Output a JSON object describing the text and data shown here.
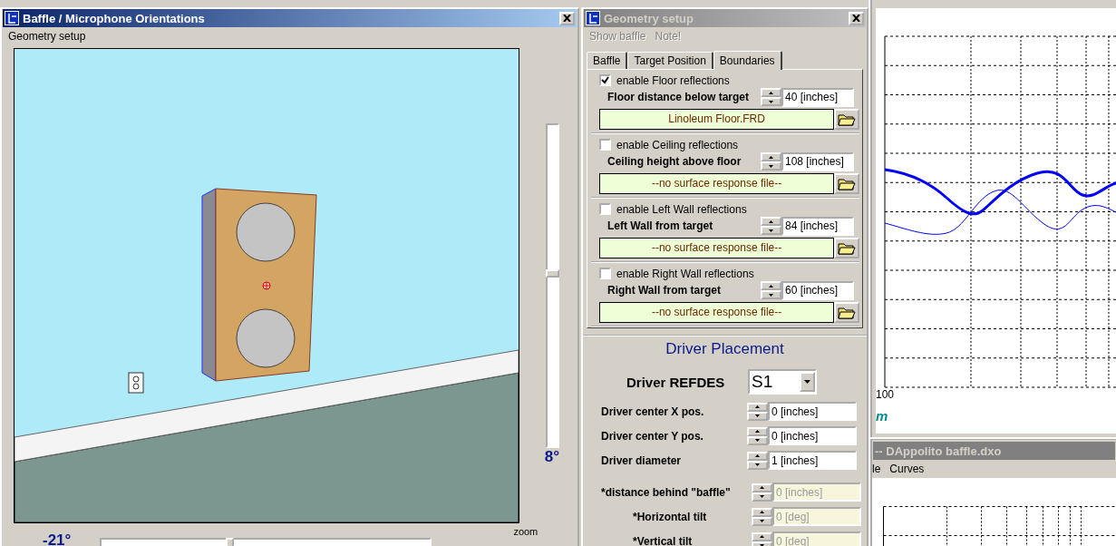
{
  "baffle_window": {
    "title": "Baffle / Microphone Orientations",
    "active": true,
    "menu": [
      "Geometry setup"
    ],
    "vertical_slider": {
      "level": 0.54
    },
    "vertical_angle": "8°",
    "horizontal_angle": "-21°",
    "horizontal_slider": {
      "level": 0.39
    },
    "zoom_label": "zoom"
  },
  "geometry_window": {
    "title": "Geometry setup",
    "active": false,
    "menu": [
      {
        "label": "Show baffle",
        "disabled": true
      },
      {
        "label": "Note!",
        "disabled": true
      }
    ],
    "tabs": [
      {
        "label": "Baffle",
        "selected": false
      },
      {
        "label": "Target Position",
        "selected": false
      },
      {
        "label": "Boundaries",
        "selected": true
      }
    ],
    "boundaries": [
      {
        "enable_label": "enable Floor reflections",
        "checked": true,
        "distance_label": "Floor distance below target",
        "value": "40 [inches]",
        "file": "Linoleum Floor.FRD"
      },
      {
        "enable_label": "enable Ceiling reflections",
        "checked": false,
        "distance_label": "Ceiling height above floor",
        "value": "108 [inches]",
        "file": "--no surface response file--"
      },
      {
        "enable_label": "enable Left Wall reflections",
        "checked": false,
        "distance_label": "Left Wall from target",
        "value": "84 [inches]",
        "file": "--no surface response file--"
      },
      {
        "enable_label": "enable Right Wall reflections",
        "checked": false,
        "distance_label": "Right Wall from target",
        "value": "60 [inches]",
        "file": "--no surface response file--"
      }
    ],
    "driver_placement": {
      "title": "Driver Placement",
      "refdes_label": "Driver REFDES",
      "refdes_value": "S1",
      "fields": [
        {
          "label": "Driver center X pos.",
          "value": "0 [inches]",
          "disabled": false
        },
        {
          "label": "Driver center Y pos.",
          "value": "0 [inches]",
          "disabled": false
        },
        {
          "label": "Driver diameter",
          "value": "1 [inches]",
          "disabled": false
        },
        {
          "label": "*distance behind \"baffle\"",
          "value": "0 [inches]",
          "disabled": true
        },
        {
          "label": "*Horizontal tilt",
          "value": "0 [deg]",
          "disabled": true
        },
        {
          "label": "*Vertical tilt",
          "value": "0 [deg]",
          "disabled": true
        }
      ]
    }
  },
  "chart_window": {
    "x_label": "100",
    "caption": "m"
  },
  "dxo_window": {
    "title": "-- DAppolito baffle.dxo",
    "active": false,
    "menu": [
      "le",
      "Curves"
    ]
  }
}
